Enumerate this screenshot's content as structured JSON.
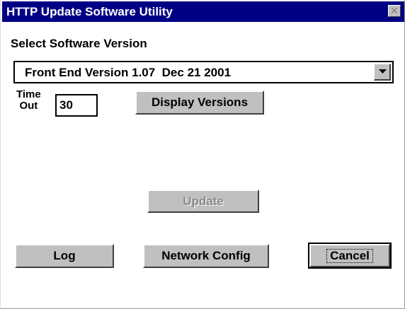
{
  "window": {
    "title": "HTTP Update Software Utility",
    "close_glyph": "✕"
  },
  "version_section": {
    "label": "Select Software Version",
    "selected_value": "Front End Version 1.07  Dec 21 2001"
  },
  "timeout": {
    "label_line1": "Time",
    "label_line2": "Out",
    "value": "30"
  },
  "buttons": {
    "display_versions": "Display Versions",
    "update": "Update",
    "log": "Log",
    "network_config": "Network Config",
    "cancel": "Cancel"
  },
  "state": {
    "update_enabled": false,
    "default_button": "cancel"
  },
  "colors": {
    "titlebar": "#000084",
    "button_face": "#c0c0c0",
    "disabled_text": "#8a8a8a"
  },
  "icons": {
    "close": "close-icon",
    "dropdown": "chevron-down-icon"
  }
}
